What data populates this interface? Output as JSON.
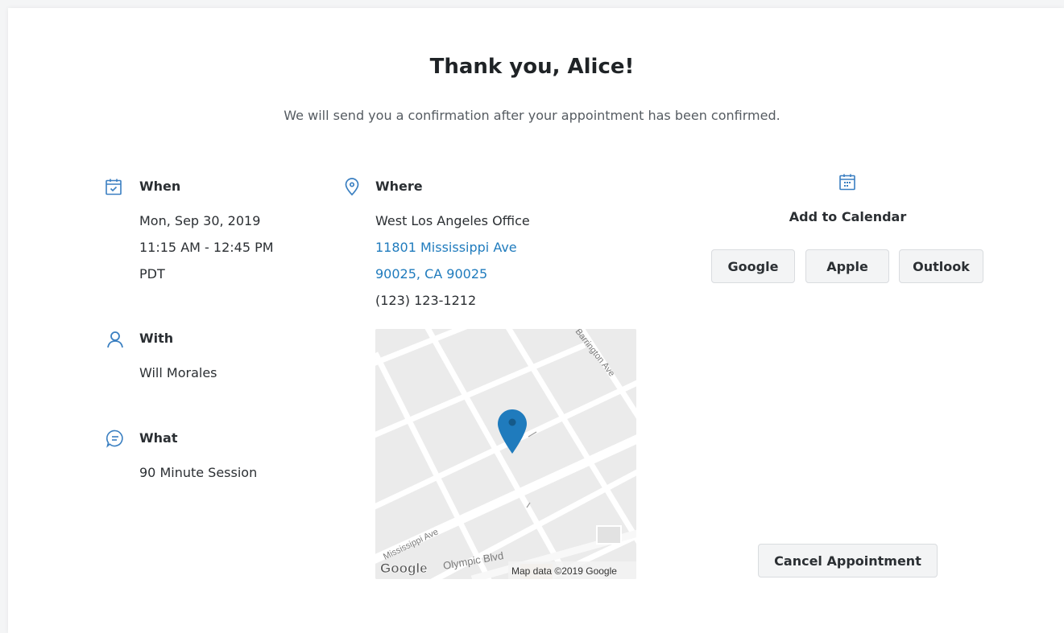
{
  "header": {
    "title": "Thank you, Alice!",
    "subtitle": "We will send you a confirmation after your appointment has been confirmed."
  },
  "when": {
    "label": "When",
    "icon": "calendar-check-icon",
    "lines": [
      "Mon, Sep 30, 2019",
      "11:15 AM - 12:45 PM",
      "PDT"
    ]
  },
  "with": {
    "label": "With",
    "icon": "user-icon",
    "name": "Will Morales"
  },
  "what": {
    "label": "What",
    "icon": "chat-bubble-icon",
    "service": "90 Minute Session"
  },
  "where": {
    "label": "Where",
    "icon": "location-pin-icon",
    "office": "West Los Angeles Office",
    "street": "11801 Mississippi Ave",
    "city": "90025, CA 90025",
    "phone": "(123) 123-1212"
  },
  "map": {
    "streets": [
      "Barrington Ave",
      "Mississippi Ave",
      "Olympic Blvd"
    ],
    "logo": "Google",
    "attribution": "Map data ©2019 Google"
  },
  "calendar": {
    "icon": "calendar-icon",
    "title": "Add to Calendar",
    "buttons": [
      "Google",
      "Apple",
      "Outlook"
    ]
  },
  "actions": {
    "cancel_label": "Cancel Appointment"
  },
  "colors": {
    "accent": "#1f7bbd",
    "icon": "#3a7fc1",
    "button_bg": "#f3f4f5",
    "map_bg": "#ececec"
  }
}
